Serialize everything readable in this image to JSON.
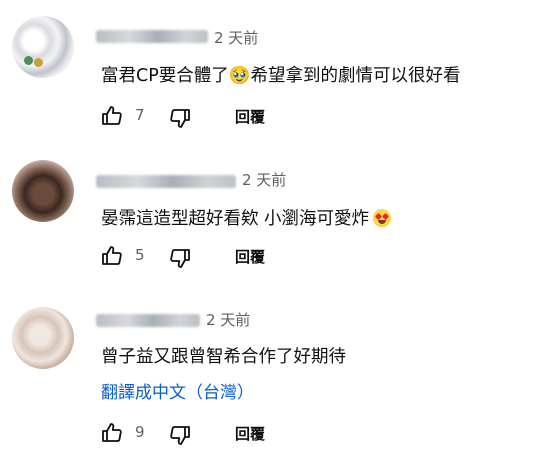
{
  "comments": [
    {
      "time": "2 天前",
      "text": "富君CP要合體了🥹希望拿到的劇情可以很好看",
      "likes": "7",
      "reply_label": "回覆"
    },
    {
      "time": "2 天前",
      "text": "晏霈這造型超好看欸 小瀏海可愛炸",
      "emoji_icon": "star-struck-emoji",
      "likes": "5",
      "reply_label": "回覆"
    },
    {
      "time": "2 天前",
      "text": "曾子益又跟曾智希合作了好期待",
      "translate_label": "翻譯成中文（台灣）",
      "likes": "9",
      "reply_label": "回覆"
    }
  ]
}
